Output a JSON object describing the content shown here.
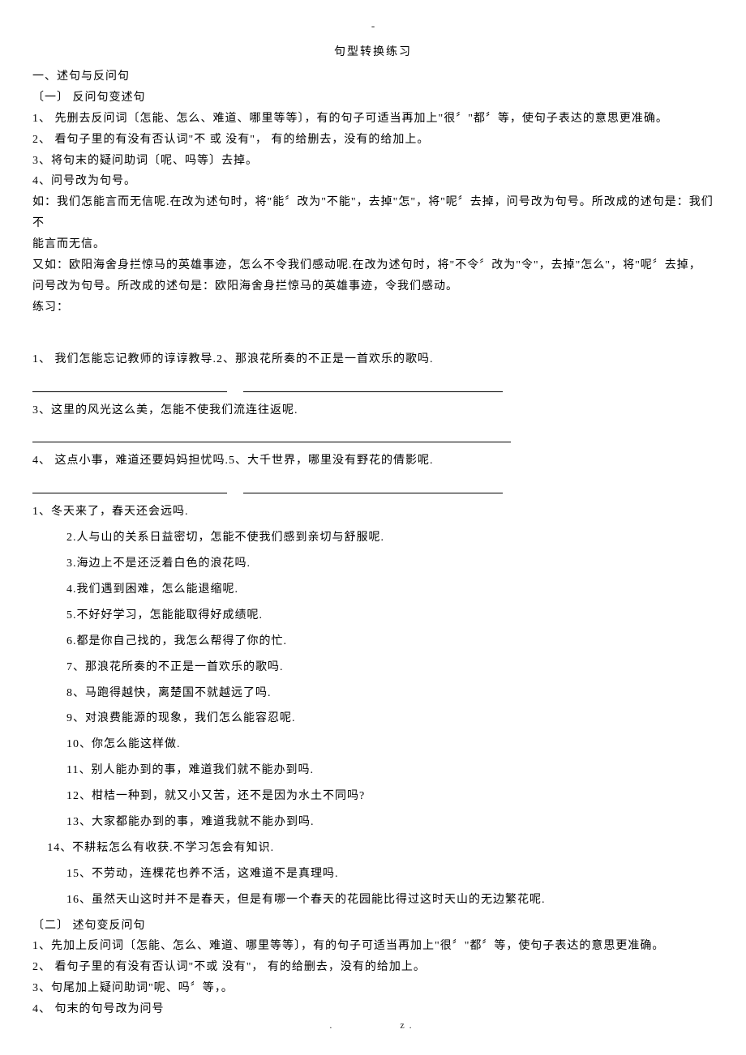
{
  "header": {
    "dash": "-",
    "title": "句型转换练习"
  },
  "section1": {
    "heading": "一、述句与反问句",
    "sub1_title": "〔一〕  反问句变述句",
    "rule1": "1、  先删去反问词〔怎能、怎么、难道、哪里等等〕，有的句子可适当再加上\"很〞\"都〞等，使句子表达的意思更准确。",
    "rule2": "2、  看句子里的有没有否认词\"不 或 没有\"， 有的给删去，没有的给加上。",
    "rule3": "3、将句末的疑问助词〔呢、吗等〕去掉。",
    "rule4": "4、问号改为句号。",
    "example1_line1": "如：我们怎能言而无信呢.在改为述句时，将\"能〞改为\"不能\"，去掉\"怎\"，将\"呢〞去掉，问号改为句号。所改成的述句是：我们不",
    "example1_line2": "能言而无信。",
    "example2_line1": "    又如：欧阳海舍身拦惊马的英雄事迹，怎么不令我们感动呢.在改为述句时，将\"不令〞改为\"令\"，去掉\"怎么\"，将\"呢〞去掉，",
    "example2_line2": "问号改为句号。所改成的述句是：欧阳海舍身拦惊马的英雄事迹，令我们感动。",
    "practice_label": "练习：",
    "q1": "1、  我们怎能忘记教师的谆谆教导.2、那浪花所奏的不正是一首欢乐的歌吗.",
    "q3": "3、这里的风光这么美，怎能不使我们流连往返呢.",
    "q4": "4、  这点小事，难道还要妈妈担忧吗.5、大千世界，哪里没有野花的倩影呢.",
    "extra": [
      "1、冬天来了，春天还会远吗.",
      "2.人与山的关系日益密切，怎能不使我们感到亲切与舒服呢.",
      "3.海边上不是还泛着白色的浪花吗.",
      "4.我们遇到困难，怎么能退缩呢.",
      "5.不好好学习，怎能能取得好成绩呢.",
      "6.都是你自己找的，我怎么帮得了你的忙.",
      "7、那浪花所奏的不正是一首欢乐的歌吗.",
      "8、马跑得越快，离楚国不就越远了吗.",
      "9、对浪费能源的现象，我们怎么能容忍呢.",
      "10、你怎么能这样做.",
      "11、别人能办到的事，难道我们就不能办到吗.",
      "12、柑桔一种到，就又小又苦，还不是因为水土不同吗?",
      "13、大家都能办到的事，难道我就不能办到吗.",
      "14、不耕耘怎么有收获.不学习怎会有知识.",
      "15、不劳动，连棵花也养不活，这难道不是真理吗.",
      "16、虽然天山这时并不是春天，但是有哪一个春天的花园能比得过这时天山的无边繁花呢."
    ]
  },
  "section2": {
    "title": "〔二〕  述句变反问句",
    "rule1": "1、先加上反问词〔怎能、怎么、难道、哪里等等〕，有的句子可适当再加上\"很〞\"都〞等，使句子表达的意思更准确。",
    "rule2": "2、 看句子里的有没有否认词\"不或 没有\"， 有的给删去，没有的给加上。",
    "rule3": "3、句尾加上疑问助词\"呢、吗〞等，。",
    "rule4": "4、 句末的句号改为问号"
  },
  "footer": {
    "left": ".",
    "right": "z."
  }
}
